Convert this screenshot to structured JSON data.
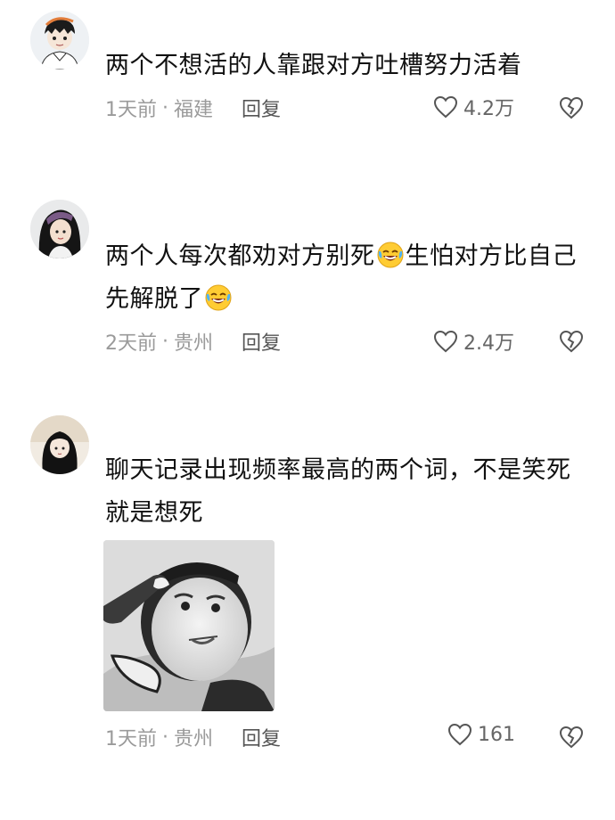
{
  "comments": [
    {
      "text": "两个不想活的人靠跟对方吐槽努力活着",
      "time": "1天前",
      "location": "福建",
      "reply_label": "回复",
      "likes": "4.2万"
    },
    {
      "text_part1": "两个人每次都劝对方别死",
      "text_part2": "生怕对方比自己先解脱了",
      "emoji": "rofl-emoji",
      "time": "2天前",
      "location": "贵州",
      "reply_label": "回复",
      "likes": "2.4万"
    },
    {
      "text": "聊天记录出现频率最高的两个词，不是笑死就是想死",
      "image": "meme-sticker-salute-face",
      "time": "1天前",
      "location": "贵州",
      "reply_label": "回复",
      "likes": "161"
    }
  ],
  "separator": "·",
  "icons": {
    "like": "heart-outline-icon",
    "dislike": "broken-heart-icon"
  },
  "colors": {
    "text": "#111111",
    "meta": "#9a9a9a",
    "icon": "#555555",
    "background": "#ffffff"
  }
}
